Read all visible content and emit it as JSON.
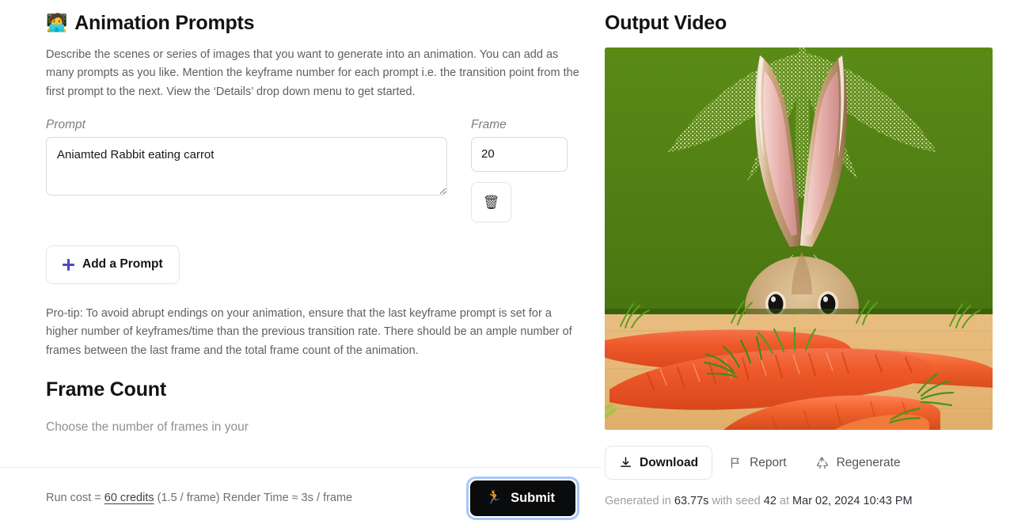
{
  "left": {
    "header": {
      "emoji": "🧑‍💻",
      "emoji_name": "technologist-emoji",
      "title": "Animation Prompts"
    },
    "description": "Describe the scenes or series of images that you want to generate into an animation. You can add as many prompts as you like. Mention the keyframe number for each prompt i.e. the transition point from the first prompt to the next. View the ‘Details’ drop down menu to get started.",
    "labels": {
      "prompt": "Prompt",
      "frame": "Frame"
    },
    "prompt_row": {
      "prompt_value": "Aniamted Rabbit eating carrot",
      "prompt_placeholder": "Prompt",
      "frame_value": "20",
      "frame_placeholder": "Frame",
      "delete_icon": "🗑"
    },
    "add_prompt_label": "Add a Prompt",
    "protip": "Pro-tip: To avoid abrupt endings on your animation, ensure that the last keyframe prompt is set for a higher number of keyframes/time than the previous transition rate. There should be an ample number of frames between the last frame and the total frame count of the animation.",
    "frame_count": {
      "title": "Frame Count",
      "subtitle": "Choose the number of frames in your"
    }
  },
  "footer": {
    "run_cost_prefix": "Run cost = ",
    "credits": "60 credits",
    "run_cost_suffix": " (1.5 / frame) Render Time ≈ 3s / frame",
    "submit_emoji": "🏃",
    "submit_label": "Submit"
  },
  "right": {
    "title": "Output Video",
    "video_alt": "Animated rabbit sitting behind a pile of large carrots on a wooden table with a green background",
    "actions": {
      "download_label": "Download",
      "report_label": "Report",
      "regenerate_label": "Regenerate"
    },
    "generation": {
      "prefix": "Generated in ",
      "duration": "63.77s",
      "mid": " with seed ",
      "seed": "42",
      "at": " at ",
      "timestamp": "Mar 02, 2024 10:43 PM"
    }
  },
  "colors": {
    "accent_plus": "#4e46c7",
    "submit_bg": "#0a0b0d",
    "focus_ring": "#a8c7f7",
    "body_text": "#5c6066",
    "heading": "#111315",
    "video_green": "#4e7a14",
    "carrot_orange": "#ef5a2a",
    "wood": "#e2b273"
  }
}
